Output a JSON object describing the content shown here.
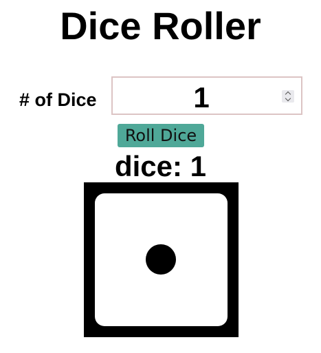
{
  "app": {
    "title": "Dice Roller"
  },
  "controls": {
    "dice_count_label": "# of Dice",
    "dice_count_value": "1",
    "roll_button_label": "Roll Dice"
  },
  "result": {
    "text": "dice: 1",
    "dice": [
      {
        "value": 1
      }
    ]
  },
  "colors": {
    "button_bg": "#4fa898",
    "input_border": "#dcc4c4",
    "die_border": "#000000",
    "die_face": "#ffffff"
  }
}
